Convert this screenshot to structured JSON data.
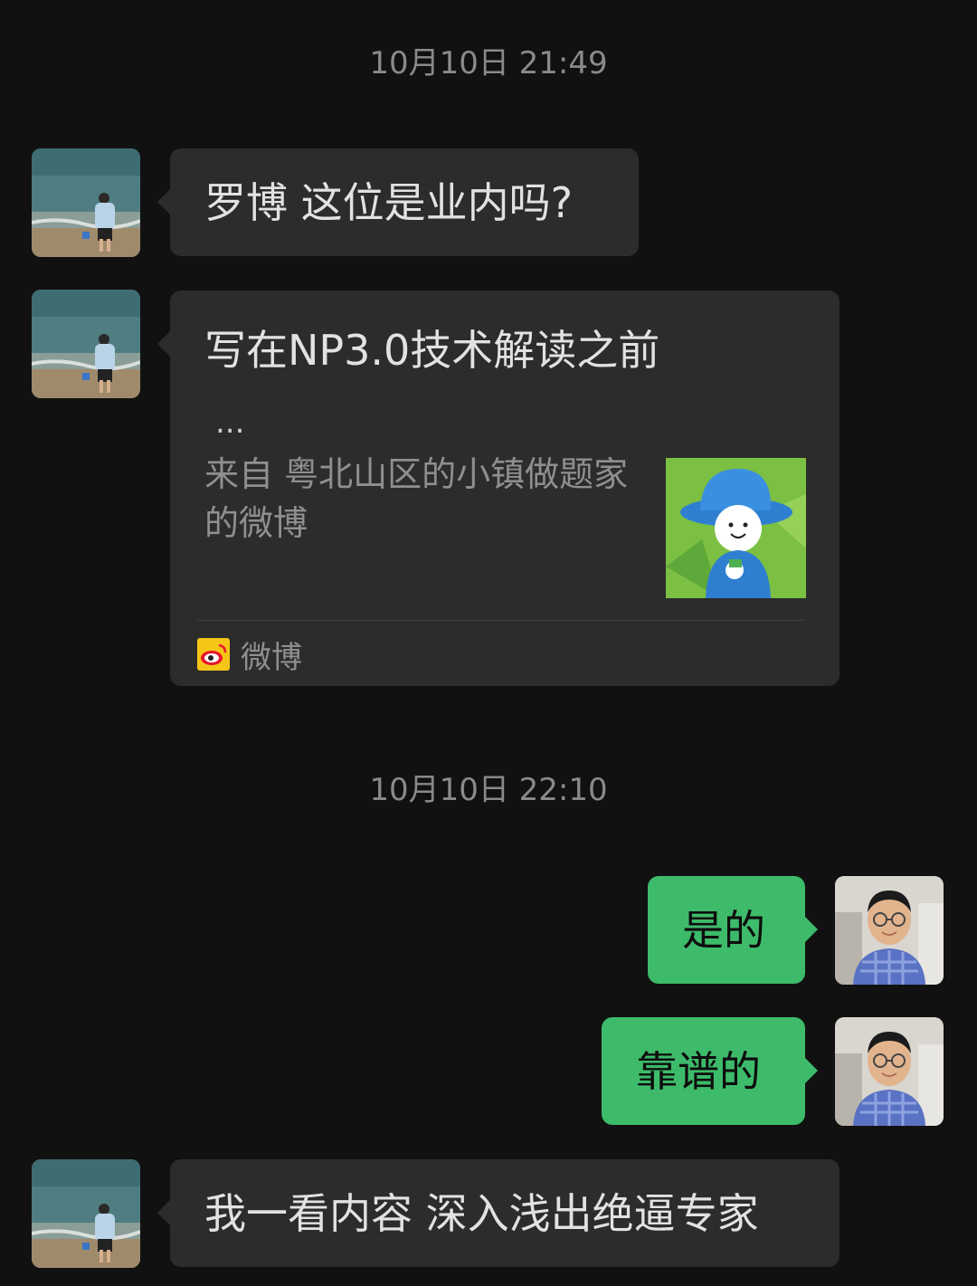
{
  "timestamps": [
    "10月10日 21:49",
    "10月10日 22:10"
  ],
  "messages": {
    "m1": "罗博 这位是业内吗?",
    "m3": "是的",
    "m4": "靠谱的",
    "m5": "我一看内容 深入浅出绝逼专家"
  },
  "link_card": {
    "title": "写在NP3.0技术解读之前",
    "ellipsis": "...",
    "source": "来自 粤北山区的小镇做题家 的微博",
    "app_name": "微博",
    "app_icon": "weibo-icon",
    "thumbnail": "cartoon-bucket-hat-icon"
  },
  "colors": {
    "background": "#111111",
    "bubble_in": "#2c2c2c",
    "bubble_out": "#3dbb6a",
    "timestamp": "#8a8a8a"
  }
}
